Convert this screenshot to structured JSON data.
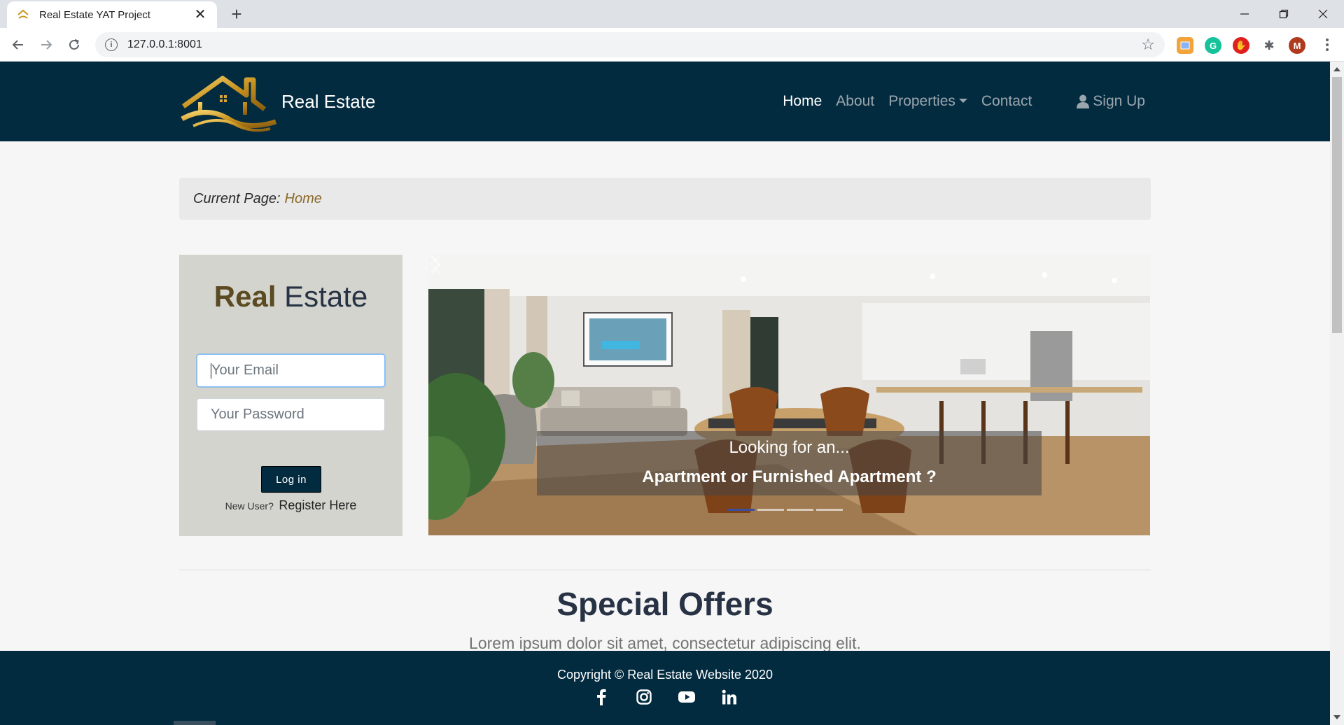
{
  "browser": {
    "tab_title": "Real Estate YAT Project",
    "url": "127.0.0.1:8001",
    "profile_initial": "M"
  },
  "navbar": {
    "brand": "Real Estate",
    "links": [
      "Home",
      "About",
      "Properties",
      "Contact"
    ],
    "active": "Home",
    "signup": "Sign Up"
  },
  "breadcrumb": {
    "label": "Current Page:",
    "page": "Home"
  },
  "login": {
    "title_part1": "Real",
    "title_part2": "Estate",
    "email_placeholder": "Your Email",
    "password_placeholder": "Your Password",
    "button": "Log in",
    "new_user": "New User?",
    "register": "Register Here"
  },
  "carousel": {
    "caption_line1": "Looking for an...",
    "caption_line2": "Apartment or Furnished Apartment ?",
    "slide_count": 4,
    "active_slide": 1
  },
  "offers": {
    "title": "Special Offers",
    "subtitle": "Lorem ipsum dolor sit amet, consectetur adipiscing elit."
  },
  "footer": {
    "copyright": "Copyright © Real Estate Website 2020",
    "socials": [
      "facebook-icon",
      "instagram-icon",
      "youtube-icon",
      "linkedin-icon"
    ]
  },
  "colors": {
    "navy": "#032b3f",
    "gold": "#8a6a2a",
    "login_bg": "#d3d4ce"
  }
}
